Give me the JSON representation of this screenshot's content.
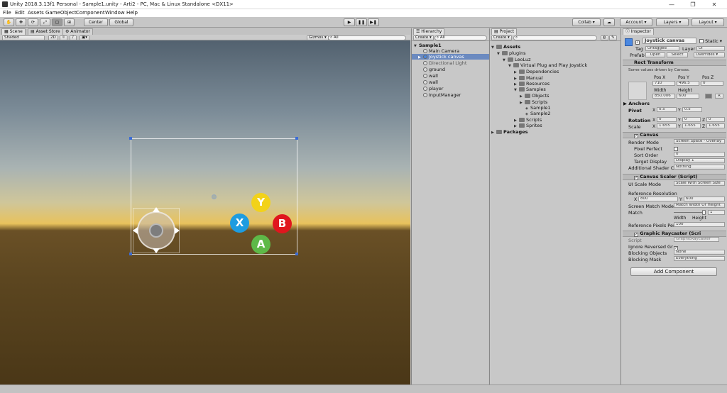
{
  "window": {
    "title": "Unity 2018.3.13f1 Personal - Sample1.unity - Arti2 - PC, Mac & Linux Standalone <DX11>",
    "minimize": "—",
    "maximize": "❐",
    "close": "✕"
  },
  "menu": [
    "File",
    "Edit",
    "Assets",
    "GameObject",
    "Component",
    "Window",
    "Help"
  ],
  "toolbar": {
    "tools": [
      "✋",
      "✥",
      "⟳",
      "⤢",
      "▢",
      "⊞"
    ],
    "pivot": "Center",
    "space": "Global",
    "play": "▶",
    "pause": "❚❚",
    "step": "▶❚",
    "collab": "Collab ▾",
    "account": "Account ▾",
    "layers": "Layers ▾",
    "layout": "Layout ▾"
  },
  "scene": {
    "tabs": [
      "Scene",
      "Asset Store",
      "Animator"
    ],
    "shading": "Shaded",
    "mode2d": "2D",
    "gizmos": "Gizmos ▾",
    "search": "All",
    "buttons": {
      "y": "Y",
      "x": "X",
      "b": "B",
      "a": "A"
    },
    "colors": {
      "y": "#f2d21a",
      "x": "#1e9ce0",
      "b": "#e0161e",
      "a": "#5eb948"
    }
  },
  "hierarchy": {
    "tab": "Hierarchy",
    "create": "Create ▾",
    "search": "All",
    "scene": "Sample1",
    "items": [
      "Main Camera",
      "Joystick canvas",
      "Directional Light",
      "ground",
      "wall",
      "wall",
      "player",
      "InputManager"
    ]
  },
  "project": {
    "tab": "Project",
    "create": "Create ▾",
    "items": [
      "Assets",
      "plugins",
      "LeoLuz",
      "Virtual Plug and Play Joystick",
      "Dependencies",
      "Manual",
      "Resources",
      "Samples",
      "Objects",
      "Scripts",
      "Sample1",
      "Sample2",
      "Scripts",
      "Sprites",
      "Packages"
    ]
  },
  "inspector": {
    "tab": "Inspector",
    "name": "Joystick canvas",
    "static": "Static ▾",
    "tag_label": "Tag",
    "tag": "Untagged",
    "layer_label": "Layer",
    "layer": "UI",
    "prefab_label": "Prefab",
    "open": "Open",
    "select": "Select",
    "overrides": "Overrides ▾",
    "rect": {
      "title": "Rect Transform",
      "note": "Some values driven by Canvas.",
      "posx_l": "Pos X",
      "posy_l": "Pos Y",
      "posz_l": "Pos Z",
      "posx": "710",
      "posy": "496.5",
      "posz": "0",
      "width_l": "Width",
      "height_l": "Height",
      "width": "850.006",
      "height": "600",
      "r": "R",
      "anchors": "Anchors",
      "pivot_l": "Pivot",
      "pivot_x": "0.5",
      "pivot_y": "0.5",
      "rotation_l": "Rotation",
      "rot_x": "0",
      "rot_y": "0",
      "rot_z": "0",
      "scale_l": "Scale",
      "sc_x": "1.655",
      "sc_y": "1.655",
      "sc_z": "1.655",
      "x": "X",
      "y": "Y",
      "z": "Z"
    },
    "canvas": {
      "title": "Canvas",
      "render_mode_l": "Render Mode",
      "render_mode": "Screen Space - Overlay",
      "pixel_perfect": "Pixel Perfect",
      "sort_order_l": "Sort Order",
      "sort_order": "0",
      "target_display_l": "Target Display",
      "target_display": "Display 1",
      "shader_l": "Additional Shader Cl",
      "shader": "Nothing"
    },
    "scaler": {
      "title": "Canvas Scaler (Script)",
      "ui_scale_l": "UI Scale Mode",
      "ui_scale": "Scale With Screen Size",
      "ref_res": "Reference Resolution",
      "rx": "800",
      "ry": "600",
      "match_mode_l": "Screen Match Mode",
      "match_mode": "Match Width Or Height",
      "match_l": "Match",
      "match": "1",
      "width": "Width",
      "height": "Height",
      "ppu_l": "Reference Pixels Per",
      "ppu": "100"
    },
    "raycaster": {
      "title": "Graphic Raycaster (Scri",
      "script_l": "Script",
      "script": "GraphicRaycaster",
      "ignore": "Ignore Reversed Gr",
      "blocking_obj_l": "Blocking Objects",
      "blocking_obj": "None",
      "blocking_mask_l": "Blocking Mask",
      "blocking_mask": "Everything"
    },
    "add_component": "Add Component"
  }
}
